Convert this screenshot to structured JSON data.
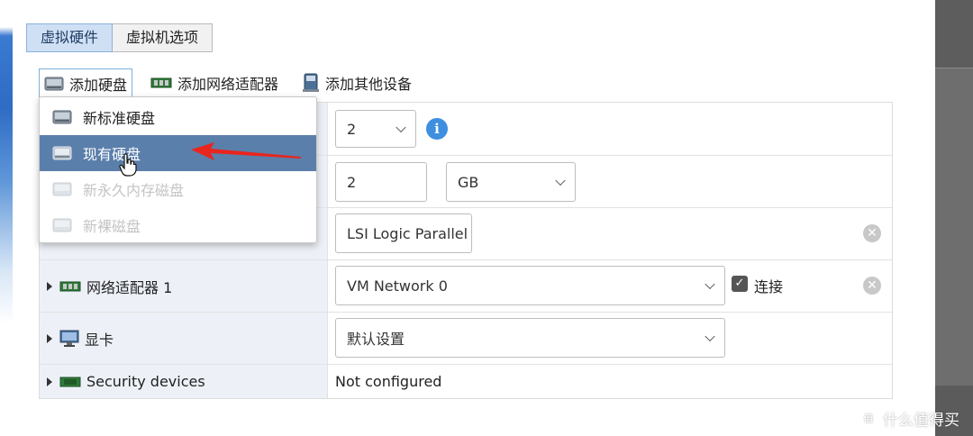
{
  "tabs": [
    {
      "label": "虚拟硬件",
      "active": true
    },
    {
      "label": "虚拟机选项",
      "active": false
    }
  ],
  "toolbar": {
    "add_disk": "添加硬盘",
    "add_network": "添加网络适配器",
    "add_other": "添加其他设备"
  },
  "menu": {
    "items": [
      {
        "label": "新标准硬盘",
        "state": "normal",
        "icon": "disk-icon"
      },
      {
        "label": "现有硬盘",
        "state": "selected",
        "icon": "disk-icon"
      },
      {
        "label": "新永久内存磁盘",
        "state": "disabled",
        "icon": "disk-icon"
      },
      {
        "label": "新裸磁盘",
        "state": "disabled",
        "icon": "disk-icon"
      }
    ]
  },
  "rows": {
    "cpu": {
      "value": "2"
    },
    "memory": {
      "value": "2",
      "unit": "GB"
    },
    "scsi": {
      "value": "LSI Logic Parallel"
    },
    "network": {
      "label": "网络适配器 1",
      "value": "VM Network 0",
      "connect_label": "连接",
      "connected": true
    },
    "display": {
      "label": "显卡",
      "value": "默认设置"
    },
    "security": {
      "label": "Security devices",
      "value": "Not configured"
    }
  },
  "watermark": {
    "text": "什么值得买",
    "mark": "值"
  },
  "colors": {
    "selected_bg": "#5b7fab",
    "tab_active": "#cfe0f5",
    "label_bg": "#edf1f7",
    "info_blue": "#3e8fe0",
    "arrow_red": "#e8251f"
  }
}
